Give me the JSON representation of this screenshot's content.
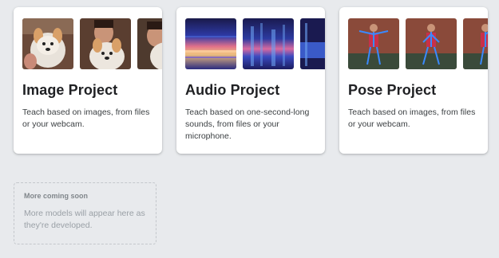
{
  "cards": [
    {
      "title": "Image Project",
      "description": "Teach based on images, from files or your webcam."
    },
    {
      "title": "Audio Project",
      "description": "Teach based on one-second-long sounds, from files or your microphone."
    },
    {
      "title": "Pose Project",
      "description": "Teach based on images, from files or your webcam."
    }
  ],
  "coming_soon": {
    "title": "More coming soon",
    "description": "More models will appear here as they're developed."
  },
  "colors": {
    "background": "#e8eaed",
    "card": "#ffffff",
    "title_text": "#202124",
    "muted_text": "#9aa0a6"
  }
}
